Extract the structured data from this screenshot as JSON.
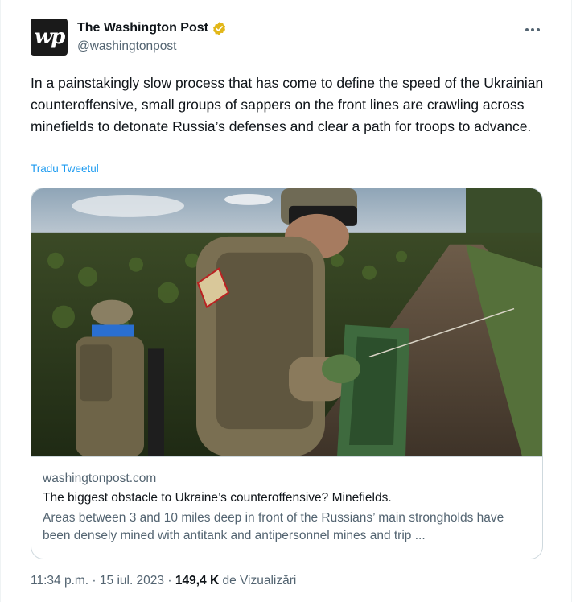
{
  "author": {
    "display_name": "The Washington Post",
    "handle": "@washingtonpost",
    "avatar_text": "wp",
    "verified_color": "#e2b719"
  },
  "more_icon": "more-horizontal-icon",
  "tweet": {
    "text": "In a painstakingly slow process that has come to define the speed of the Ukrainian counteroffensive, small groups of sappers on the front lines are crawling across minefields to detonate Russia’s defenses and clear a path for troops to advance.",
    "translate_label": "Tradu Tweetul"
  },
  "card": {
    "domain": "washingtonpost.com",
    "title": "The biggest obstacle to Ukraine’s counteroffensive? Minefields.",
    "description": "Areas between 3 and 10 miles deep in front of the Russians’ main strongholds have been densely mined with antitank and antipersonnel mines and trip ..."
  },
  "meta": {
    "time": "11:34 p.m.",
    "separator": "·",
    "date": "15 iul. 2023",
    "views_count": "149,4 K",
    "views_label": "de Vizualizări"
  },
  "colors": {
    "accent": "#1d9bf0",
    "text_primary": "#0f1419",
    "text_secondary": "#536471",
    "border": "#cfd9de"
  }
}
